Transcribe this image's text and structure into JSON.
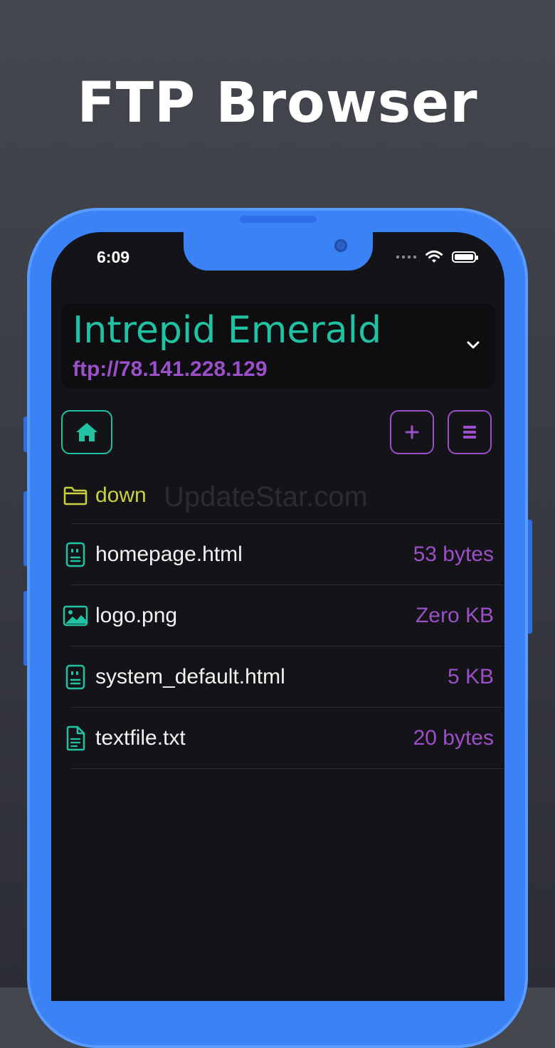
{
  "headline": "FTP Browser",
  "status_bar": {
    "time": "6:09"
  },
  "server": {
    "name": "Intrepid Emerald",
    "url": "ftp://78.141.228.129"
  },
  "watermark": "UpdateStar.com",
  "files": [
    {
      "name": "down",
      "size": "",
      "kind": "folder",
      "icon": "folder-icon"
    },
    {
      "name": "homepage.html",
      "size": "53 bytes",
      "kind": "html",
      "icon": "html-file-icon"
    },
    {
      "name": "logo.png",
      "size": "Zero KB",
      "kind": "image",
      "icon": "image-file-icon"
    },
    {
      "name": "system_default.html",
      "size": "5 KB",
      "kind": "html",
      "icon": "html-file-icon"
    },
    {
      "name": "textfile.txt",
      "size": "20 bytes",
      "kind": "text",
      "icon": "text-file-icon"
    }
  ],
  "colors": {
    "accent_teal": "#20c2a3",
    "accent_purple": "#9b4fc9",
    "folder_yellow": "#cbd040",
    "phone_blue": "#3b82f6",
    "screen_bg": "#141418"
  }
}
